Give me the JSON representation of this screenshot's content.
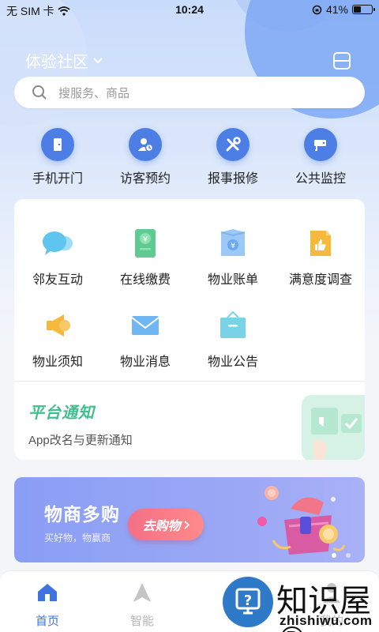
{
  "status_bar": {
    "carrier": "无 SIM 卡",
    "time": "10:24",
    "battery": "41%",
    "battery_level": 0.41
  },
  "header": {
    "community_name": "体验社区"
  },
  "search": {
    "placeholder": "搜服务、商品"
  },
  "quick_actions": [
    {
      "label": "手机开门",
      "icon": "door-icon"
    },
    {
      "label": "访客预约",
      "icon": "visitor-icon"
    },
    {
      "label": "报事报修",
      "icon": "tools-icon"
    },
    {
      "label": "公共监控",
      "icon": "camera-icon"
    }
  ],
  "services": [
    {
      "label": "邻友互动",
      "icon": "chat-bubble-icon"
    },
    {
      "label": "在线缴费",
      "icon": "payment-icon"
    },
    {
      "label": "物业账单",
      "icon": "bill-icon"
    },
    {
      "label": "满意度调查",
      "icon": "thumb-up-icon"
    },
    {
      "label": "物业须知",
      "icon": "megaphone-icon"
    },
    {
      "label": "物业消息",
      "icon": "envelope-icon"
    },
    {
      "label": "物业公告",
      "icon": "announcement-icon"
    }
  ],
  "notice": {
    "title": "平台通知",
    "text": "App改名与更新通知"
  },
  "banner": {
    "title": "物商多购",
    "subtitle": "买好物，物赢商",
    "button": "去购物"
  },
  "tabbar": [
    {
      "label": "首页",
      "icon": "home-icon",
      "active": true
    },
    {
      "label": "智能",
      "icon": "navigation-icon",
      "active": false
    },
    {
      "label": "",
      "icon": "service-icon",
      "active": false
    },
    {
      "label": "我的",
      "icon": "profile-icon",
      "active": false
    }
  ],
  "watermark": {
    "main": "知识屋®",
    "sub": "zhishiwu.com"
  },
  "colors": {
    "accent": "#4d7ee6",
    "tab_active": "#3f74e0",
    "notice_green": "#3fbf8e",
    "banner_button": "#f36f85"
  }
}
